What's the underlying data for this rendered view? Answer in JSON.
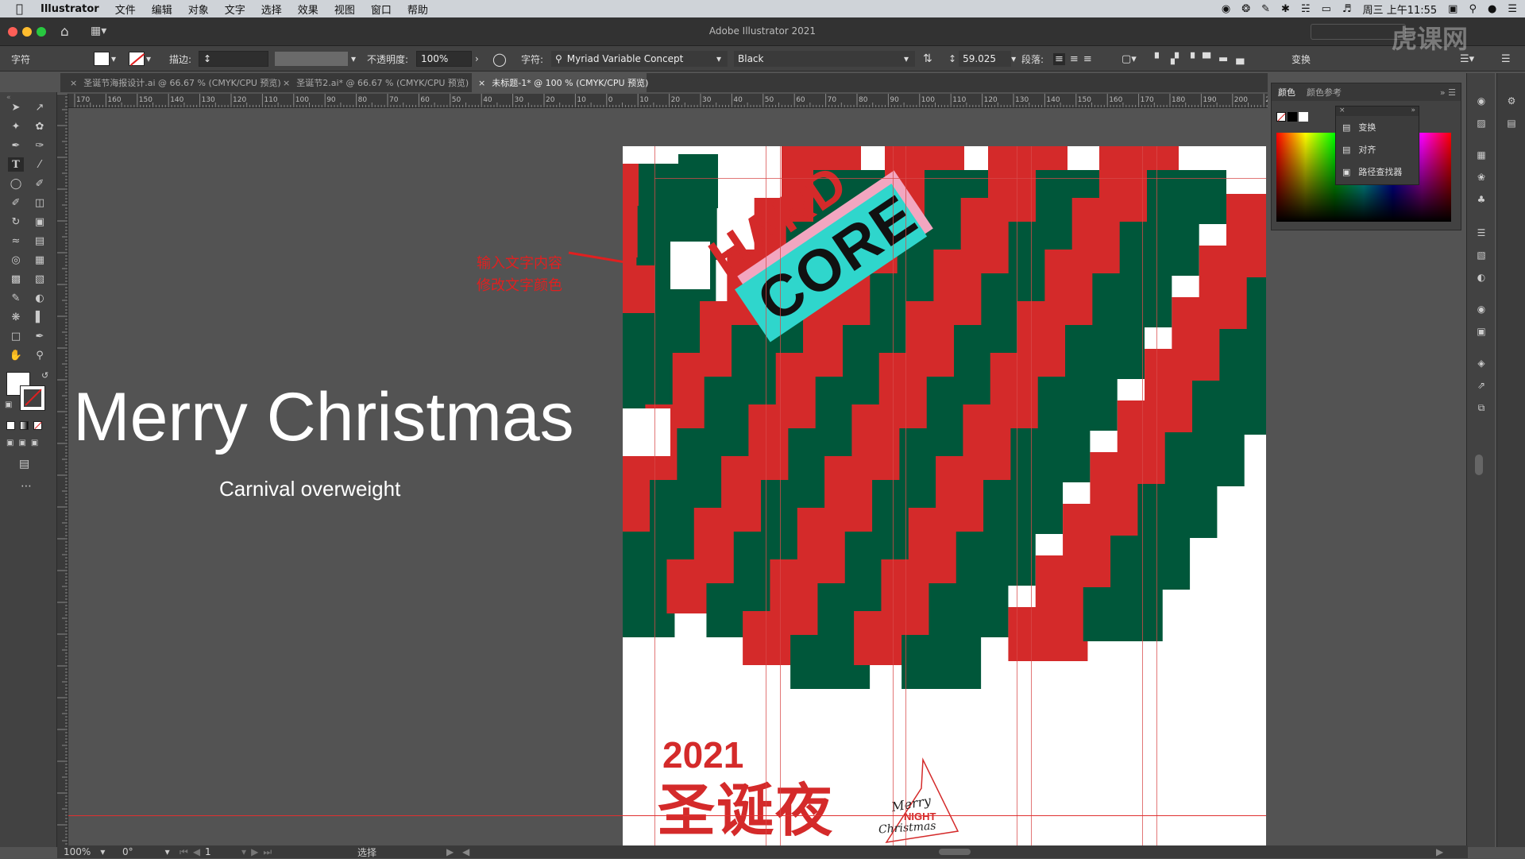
{
  "menubar": {
    "apple": "",
    "app_name": "Illustrator",
    "items": [
      "文件",
      "编辑",
      "对象",
      "文字",
      "选择",
      "效果",
      "视图",
      "窗口",
      "帮助"
    ],
    "clock": "周三 上午11:55"
  },
  "window": {
    "title": "Adobe Illustrator 2021"
  },
  "control_bar": {
    "panel_label": "字符",
    "stroke_label": "描边:",
    "opacity_label": "不透明度:",
    "opacity_value": "100%",
    "char_label": "字符:",
    "font_family": "Myriad Variable Concept",
    "font_style": "Black",
    "font_size": "59.025",
    "paragraph_label": "段落:",
    "transform_label": "变换"
  },
  "tabs": [
    {
      "label": "圣诞节海报设计.ai @ 66.67 % (CMYK/CPU 预览)",
      "active": false
    },
    {
      "label": "圣诞节2.ai* @ 66.67 % (CMYK/CPU 预览)",
      "active": false
    },
    {
      "label": "未标题-1* @ 100 % (CMYK/CPU 预览)",
      "active": true
    }
  ],
  "ruler_top_labels": [
    "170",
    "160",
    "150",
    "140",
    "130",
    "120",
    "110",
    "100",
    "90",
    "80",
    "70",
    "60",
    "50",
    "40",
    "30",
    "20",
    "10",
    "0",
    "10",
    "20",
    "30",
    "40",
    "50",
    "60",
    "70",
    "80",
    "90",
    "100",
    "110",
    "120",
    "130",
    "140",
    "150",
    "160",
    "170",
    "180",
    "190",
    "200",
    "210"
  ],
  "canvas": {
    "big_text": "Merry Christmas",
    "sub_text": "Carnival overweight",
    "annotation_line1": "输入文字内容",
    "annotation_line2": "修改文字颜色"
  },
  "artboard": {
    "tag_hard": "HARD",
    "tag_core": "CORE",
    "year": "2021",
    "title_cn": "圣诞夜",
    "script_merry": "Merry",
    "script_night": "NIGHT",
    "script_christmas": "Christmas"
  },
  "panels": {
    "color_tab": "颜色",
    "color_guide_tab": "颜色参考",
    "popup_items": [
      "变换",
      "对齐",
      "路径查找器"
    ]
  },
  "statusbar": {
    "zoom": "100%",
    "rotation": "0°",
    "artboard_num": "1",
    "tool_status": "选择"
  },
  "watermark": "虎课网",
  "colors": {
    "red": "#d42a2a",
    "green": "#00573a",
    "teal": "#2fd6cc",
    "pink": "#f2a6c0",
    "ui_dark": "#424242",
    "canvas_bg": "#535353",
    "annotation": "#e02020"
  }
}
